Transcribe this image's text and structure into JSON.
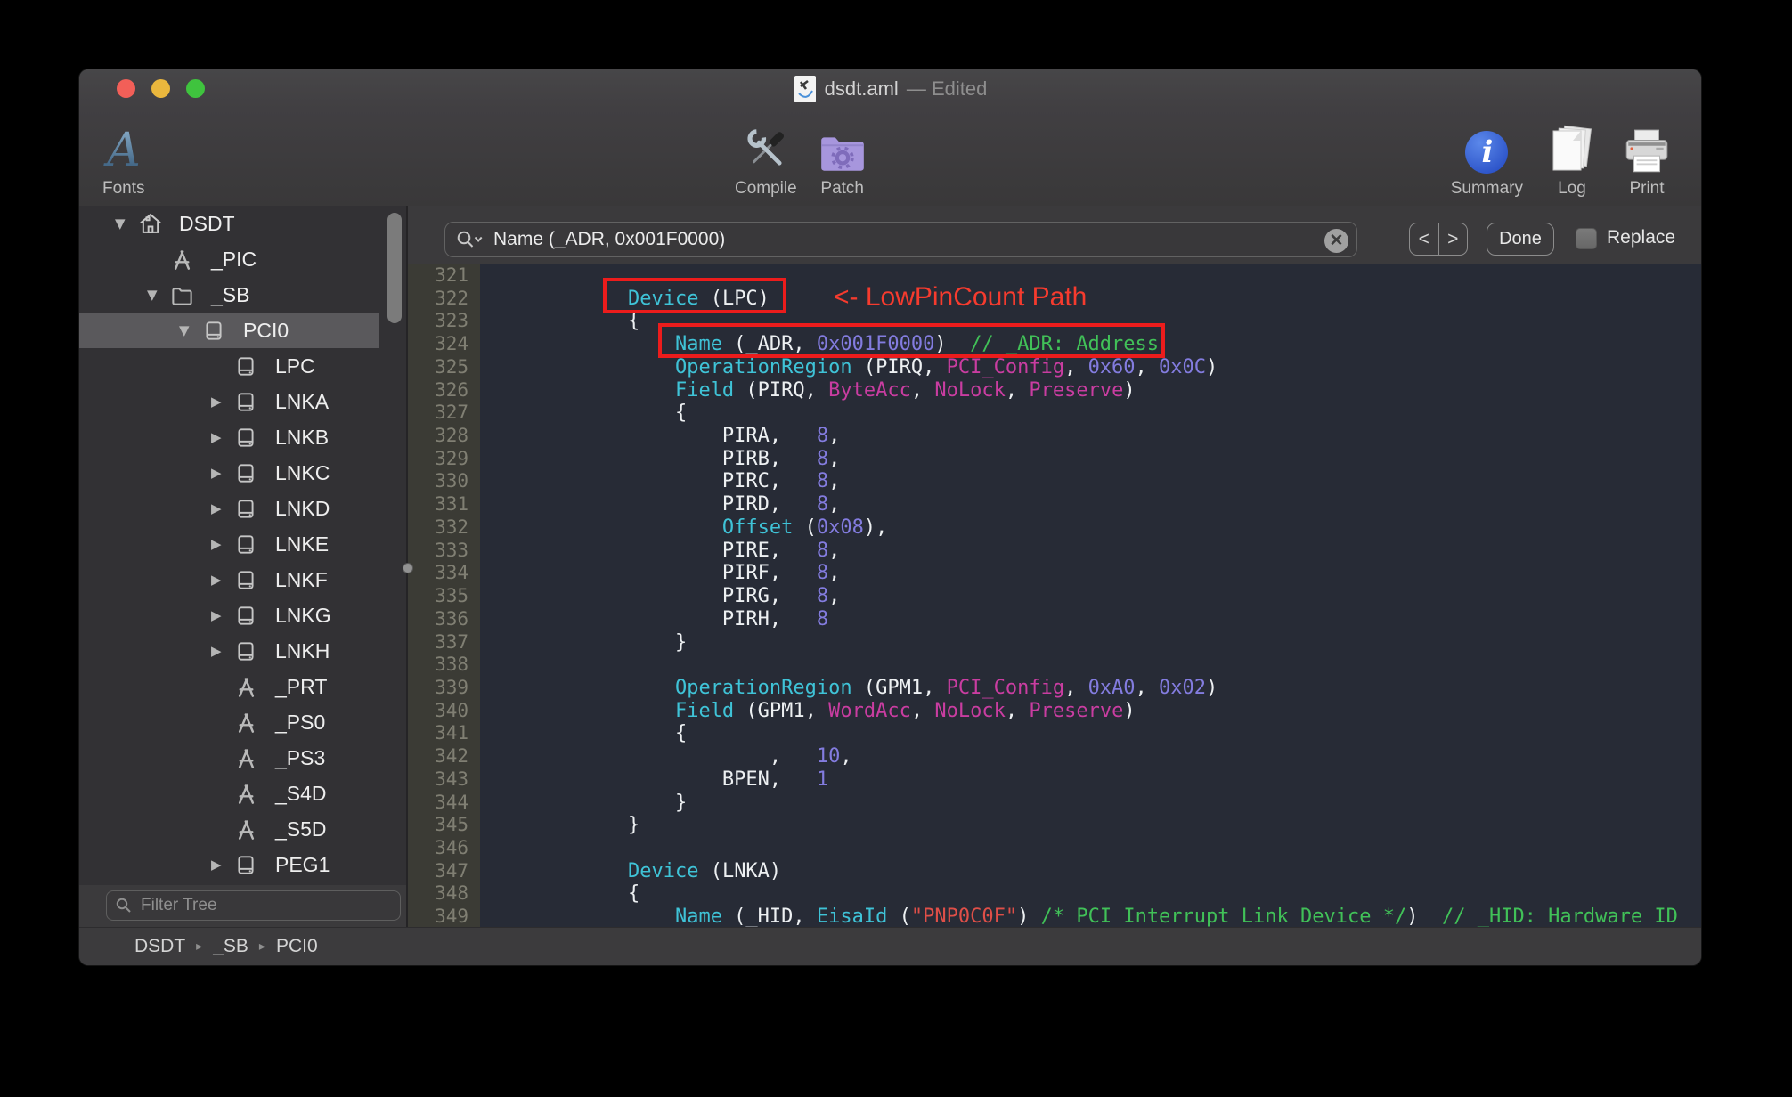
{
  "window": {
    "title": "dsdt.aml",
    "title_suffix": "— Edited"
  },
  "toolbar": {
    "left": [
      {
        "id": "fonts",
        "label": "Fonts"
      }
    ],
    "center": [
      {
        "id": "compile",
        "label": "Compile"
      },
      {
        "id": "patch",
        "label": "Patch"
      }
    ],
    "right": [
      {
        "id": "summary",
        "label": "Summary"
      },
      {
        "id": "log",
        "label": "Log"
      },
      {
        "id": "print",
        "label": "Print"
      }
    ]
  },
  "sidebar": {
    "filter_placeholder": "Filter Tree",
    "tree": [
      {
        "label": "DSDT",
        "icon": "house",
        "level": 0,
        "disclosure": "open",
        "selected": false
      },
      {
        "label": "_PIC",
        "icon": "method",
        "level": 1,
        "disclosure": "none",
        "selected": false
      },
      {
        "label": "_SB",
        "icon": "folder",
        "level": 1,
        "disclosure": "open",
        "selected": false
      },
      {
        "label": "PCI0",
        "icon": "device",
        "level": 2,
        "disclosure": "open",
        "selected": true
      },
      {
        "label": "LPC",
        "icon": "device",
        "level": 3,
        "disclosure": "none",
        "selected": false
      },
      {
        "label": "LNKA",
        "icon": "device",
        "level": 3,
        "disclosure": "closed",
        "selected": false
      },
      {
        "label": "LNKB",
        "icon": "device",
        "level": 3,
        "disclosure": "closed",
        "selected": false
      },
      {
        "label": "LNKC",
        "icon": "device",
        "level": 3,
        "disclosure": "closed",
        "selected": false
      },
      {
        "label": "LNKD",
        "icon": "device",
        "level": 3,
        "disclosure": "closed",
        "selected": false
      },
      {
        "label": "LNKE",
        "icon": "device",
        "level": 3,
        "disclosure": "closed",
        "selected": false
      },
      {
        "label": "LNKF",
        "icon": "device",
        "level": 3,
        "disclosure": "closed",
        "selected": false
      },
      {
        "label": "LNKG",
        "icon": "device",
        "level": 3,
        "disclosure": "closed",
        "selected": false
      },
      {
        "label": "LNKH",
        "icon": "device",
        "level": 3,
        "disclosure": "closed",
        "selected": false
      },
      {
        "label": "_PRT",
        "icon": "method",
        "level": 3,
        "disclosure": "none",
        "selected": false
      },
      {
        "label": "_PS0",
        "icon": "method",
        "level": 3,
        "disclosure": "none",
        "selected": false
      },
      {
        "label": "_PS3",
        "icon": "method",
        "level": 3,
        "disclosure": "none",
        "selected": false
      },
      {
        "label": "_S4D",
        "icon": "method",
        "level": 3,
        "disclosure": "none",
        "selected": false
      },
      {
        "label": "_S5D",
        "icon": "method",
        "level": 3,
        "disclosure": "none",
        "selected": false
      },
      {
        "label": "PEG1",
        "icon": "device",
        "level": 3,
        "disclosure": "closed",
        "selected": false
      }
    ]
  },
  "findbar": {
    "query": "Name (_ADR, 0x001F0000)",
    "done_label": "Done",
    "replace_label": "Replace"
  },
  "breadcrumb": [
    "DSDT",
    "_SB",
    "PCI0"
  ],
  "editor": {
    "annotation": "<- LowPinCount Path",
    "lines": [
      {
        "n": 321,
        "s": []
      },
      {
        "n": 322,
        "s": [
          [
            "p",
            "        "
          ],
          [
            "k",
            "Device"
          ],
          [
            "p",
            " (LPC)"
          ]
        ]
      },
      {
        "n": 323,
        "s": [
          [
            "p",
            "        {"
          ]
        ]
      },
      {
        "n": 324,
        "s": [
          [
            "p",
            "            "
          ],
          [
            "k",
            "Name"
          ],
          [
            "p",
            " (_ADR, "
          ],
          [
            "n",
            "0x001F0000"
          ],
          [
            "p",
            ")  "
          ],
          [
            "c",
            "// _ADR: Address"
          ]
        ]
      },
      {
        "n": 325,
        "s": [
          [
            "p",
            "            "
          ],
          [
            "k",
            "OperationRegion"
          ],
          [
            "p",
            " (PIRQ, "
          ],
          [
            "t",
            "PCI_Config"
          ],
          [
            "p",
            ", "
          ],
          [
            "n",
            "0x60"
          ],
          [
            "p",
            ", "
          ],
          [
            "n",
            "0x0C"
          ],
          [
            "p",
            ")"
          ]
        ]
      },
      {
        "n": 326,
        "s": [
          [
            "p",
            "            "
          ],
          [
            "k",
            "Field"
          ],
          [
            "p",
            " (PIRQ, "
          ],
          [
            "t",
            "ByteAcc"
          ],
          [
            "p",
            ", "
          ],
          [
            "t",
            "NoLock"
          ],
          [
            "p",
            ", "
          ],
          [
            "t",
            "Preserve"
          ],
          [
            "p",
            ")"
          ]
        ]
      },
      {
        "n": 327,
        "s": [
          [
            "p",
            "            {"
          ]
        ]
      },
      {
        "n": 328,
        "s": [
          [
            "p",
            "                PIRA,   "
          ],
          [
            "n",
            "8"
          ],
          [
            "p",
            ","
          ]
        ]
      },
      {
        "n": 329,
        "s": [
          [
            "p",
            "                PIRB,   "
          ],
          [
            "n",
            "8"
          ],
          [
            "p",
            ","
          ]
        ]
      },
      {
        "n": 330,
        "s": [
          [
            "p",
            "                PIRC,   "
          ],
          [
            "n",
            "8"
          ],
          [
            "p",
            ","
          ]
        ]
      },
      {
        "n": 331,
        "s": [
          [
            "p",
            "                PIRD,   "
          ],
          [
            "n",
            "8"
          ],
          [
            "p",
            ","
          ]
        ]
      },
      {
        "n": 332,
        "s": [
          [
            "p",
            "                "
          ],
          [
            "k",
            "Offset"
          ],
          [
            "p",
            " ("
          ],
          [
            "n",
            "0x08"
          ],
          [
            "p",
            "),"
          ]
        ]
      },
      {
        "n": 333,
        "s": [
          [
            "p",
            "                PIRE,   "
          ],
          [
            "n",
            "8"
          ],
          [
            "p",
            ","
          ]
        ]
      },
      {
        "n": 334,
        "s": [
          [
            "p",
            "                PIRF,   "
          ],
          [
            "n",
            "8"
          ],
          [
            "p",
            ","
          ]
        ]
      },
      {
        "n": 335,
        "s": [
          [
            "p",
            "                PIRG,   "
          ],
          [
            "n",
            "8"
          ],
          [
            "p",
            ","
          ]
        ]
      },
      {
        "n": 336,
        "s": [
          [
            "p",
            "                PIRH,   "
          ],
          [
            "n",
            "8"
          ]
        ]
      },
      {
        "n": 337,
        "s": [
          [
            "p",
            "            }"
          ]
        ]
      },
      {
        "n": 338,
        "s": []
      },
      {
        "n": 339,
        "s": [
          [
            "p",
            "            "
          ],
          [
            "k",
            "OperationRegion"
          ],
          [
            "p",
            " (GPM1, "
          ],
          [
            "t",
            "PCI_Config"
          ],
          [
            "p",
            ", "
          ],
          [
            "n",
            "0xA0"
          ],
          [
            "p",
            ", "
          ],
          [
            "n",
            "0x02"
          ],
          [
            "p",
            ")"
          ]
        ]
      },
      {
        "n": 340,
        "s": [
          [
            "p",
            "            "
          ],
          [
            "k",
            "Field"
          ],
          [
            "p",
            " (GPM1, "
          ],
          [
            "t",
            "WordAcc"
          ],
          [
            "p",
            ", "
          ],
          [
            "t",
            "NoLock"
          ],
          [
            "p",
            ", "
          ],
          [
            "t",
            "Preserve"
          ],
          [
            "p",
            ")"
          ]
        ]
      },
      {
        "n": 341,
        "s": [
          [
            "p",
            "            {"
          ]
        ]
      },
      {
        "n": 342,
        "s": [
          [
            "p",
            "                    ,   "
          ],
          [
            "n",
            "10"
          ],
          [
            "p",
            ","
          ]
        ]
      },
      {
        "n": 343,
        "s": [
          [
            "p",
            "                BPEN,   "
          ],
          [
            "n",
            "1"
          ]
        ]
      },
      {
        "n": 344,
        "s": [
          [
            "p",
            "            }"
          ]
        ]
      },
      {
        "n": 345,
        "s": [
          [
            "p",
            "        }"
          ]
        ]
      },
      {
        "n": 346,
        "s": []
      },
      {
        "n": 347,
        "s": [
          [
            "p",
            "        "
          ],
          [
            "k",
            "Device"
          ],
          [
            "p",
            " (LNKA)"
          ]
        ]
      },
      {
        "n": 348,
        "s": [
          [
            "p",
            "        {"
          ]
        ]
      },
      {
        "n": 349,
        "s": [
          [
            "p",
            "            "
          ],
          [
            "k",
            "Name"
          ],
          [
            "p",
            " (_HID, "
          ],
          [
            "k",
            "EisaId"
          ],
          [
            "p",
            " ("
          ],
          [
            "s",
            "\"PNP0C0F\""
          ],
          [
            "p",
            ") "
          ],
          [
            "c",
            "/* PCI Interrupt Link Device */"
          ],
          [
            "p",
            ")  "
          ],
          [
            "c",
            "// _HID: Hardware ID"
          ]
        ]
      }
    ]
  },
  "colors": {
    "keyword": "#3fc3d7",
    "plain": "#edf0f2",
    "number": "#837cdf",
    "access_type": "#c93da1",
    "comment": "#41c158",
    "string": "#df4f48",
    "annotation_red": "#f63b2e",
    "editor_bg": "#272b36",
    "gutter_bg": "#3b3b35"
  }
}
